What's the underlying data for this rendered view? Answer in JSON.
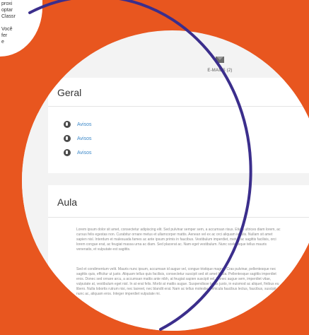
{
  "corner_text": {
    "line1": "proxi",
    "line2": "optar",
    "line3": "Classr",
    "line4": "Você",
    "line5": "fer",
    "line6": "e"
  },
  "header": {
    "mail_label": "E-MAILS (2)",
    "mail_icon": "envelope-icon"
  },
  "sidebar": {
    "icons": [
      "star-icon",
      "dashboard-icon",
      "home-icon",
      "calendar-icon",
      "list-icon"
    ]
  },
  "geral": {
    "title": "Geral",
    "items": [
      {
        "label": "Avisos",
        "icon": "forum-icon"
      },
      {
        "label": "Avisos",
        "icon": "forum-icon"
      },
      {
        "label": "Avisos",
        "icon": "forum-icon"
      }
    ]
  },
  "aula": {
    "title": "Aula",
    "paragraph1": "Lorem ipsum dolor sit amet, consectetur adipiscing elit. Sed pulvinar semper sem, a accumsan risus. Etiam ultrices diam lorem, ac cursus felis egestas non. Curabitur ornare metus et ullamcorper mattis. Aenean vel ex ac orci aliquam iaculis. Nullam sit amet sapien nisl. Interdum et malesuada fames ac ante ipsum primis in faucibus. Vestibulum imperdiet, metus ac sagittis facilisis, orci lorem congue erat, ac feugiat massa urna ac diam. Sed placerat ac. Nam eget vestibulum. Nunc scelerisque tellus mauris venenatis, et vulputate est sagittis.",
    "paragraph2": "Sed et condimentum velit. Mauris nunc ipsum, accumsan id augue vel, congue tristique magna. Cras pulvinar, pellentesque nec sagittis quis, efficitur ut justo. Aliquam tellus quis facilisis, consectetur suscipit sed sit amet ligula. Pellentesque sagittis imperdiet eros. Donec sed ornare arcu, a accumsan mattis ante nibh, at feugiat sapien suscipit vel. Donec augue sem, imperdiet vitae, vulputate at, vestibulum eget nisl. In at erat felis. Morbi at mattis augue. Suspendisse lacus justo, in euismod ac aliquet, finibus eu libero. Nulla lobortis rutrum nisi, nec laoreet, nec blandit erat. Nam ac tellus molestie, vehicula faucibus lectus, faucibus, suscipit nunc ac, aliquam eros. Integer imperdiet vulputate mi."
  },
  "colors": {
    "background": "#e8561f",
    "ring": "#3b2e8c",
    "link": "#3a87c8"
  }
}
